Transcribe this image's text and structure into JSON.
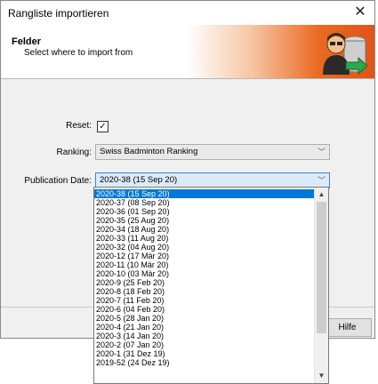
{
  "window": {
    "title": "Rangliste importieren",
    "close_glyph": "✕"
  },
  "header": {
    "title": "Felder",
    "subtitle": "Select where to import from",
    "art_icon": "person-database-import-icon"
  },
  "form": {
    "reset_label": "Reset:",
    "reset_checked": true,
    "ranking_label": "Ranking:",
    "ranking_value": "Swiss Badminton Ranking",
    "publication_label": "Publication Date:",
    "publication_value": "2020-38 (15 Sep 20)"
  },
  "buttons": {
    "help": "Hilfe"
  },
  "publication_options": [
    "2020-38 (15 Sep 20)",
    "2020-37 (08 Sep 20)",
    "2020-36 (01 Sep 20)",
    "2020-35 (25 Aug 20)",
    "2020-34 (18 Aug 20)",
    "2020-33 (11 Aug 20)",
    "2020-32 (04 Aug 20)",
    "2020-12 (17 Mär 20)",
    "2020-11 (10 Mär 20)",
    "2020-10 (03 Mär 20)",
    "2020-9 (25 Feb 20)",
    "2020-8 (18 Feb 20)",
    "2020-7 (11 Feb 20)",
    "2020-6 (04 Feb 20)",
    "2020-5 (28 Jan 20)",
    "2020-4 (21 Jan 20)",
    "2020-3 (14 Jan 20)",
    "2020-2 (07 Jan 20)",
    "2020-1 (31 Dez 19)",
    "2019-52 (24 Dez 19)"
  ],
  "selected_index": 0,
  "colors": {
    "selection": "#0078d7",
    "header_accent": "#e2531a"
  }
}
